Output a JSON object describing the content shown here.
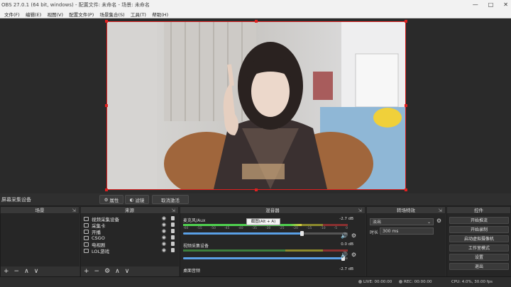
{
  "title_bar": {
    "title": "OBS 27.0.1 (64 bit, windows) - 配置文件: 未命名 - 场景: 未命名",
    "minimize": "—",
    "maximize": "□",
    "close": "✕"
  },
  "menu": [
    "文件(F)",
    "编辑(E)",
    "视图(V)",
    "配置文件(P)",
    "场景集合(S)",
    "工具(T)",
    "帮助(H)"
  ],
  "preview_controls": {
    "source_label": "屏幕采集设备",
    "properties_label": "属性",
    "filters_label": "滤镜",
    "deactivate_label": "取消激活"
  },
  "docks": {
    "scenes": "场景",
    "sources": "来源",
    "mixer": "混音器",
    "transitions": "转场特效",
    "controls": "控件"
  },
  "sources": [
    {
      "name": "视频采集设备"
    },
    {
      "name": "采集卡"
    },
    {
      "name": "开播"
    },
    {
      "name": "CSGO"
    },
    {
      "name": "电视剧"
    },
    {
      "name": "LOL游戏"
    }
  ],
  "mixer": {
    "channels": [
      {
        "name": "麦克风/Aux",
        "db": "-2.7 dB",
        "level": 0.72,
        "volume": 0.72
      },
      {
        "name": "视频采集设备",
        "db": "0.0 dB",
        "level": 0.0,
        "volume": 0.97
      },
      {
        "name": "桌面音频",
        "db": "-2.7 dB",
        "level": 0.0,
        "volume": 0.72
      }
    ],
    "tick_labels": [
      "-60",
      "-55",
      "-50",
      "-45",
      "-40",
      "-35",
      "-30",
      "-25",
      "-20",
      "-15",
      "-10",
      "-5",
      "0"
    ],
    "tooltip": "截图(Alt + A)"
  },
  "transitions": {
    "selected": "淡出",
    "duration_label": "时长",
    "duration_value": "300 ms"
  },
  "controls": [
    "开始推流",
    "开始录制",
    "启动虚拟摄像机",
    "工作室模式",
    "设置",
    "退出"
  ],
  "tools_icons": {
    "add": "+",
    "remove": "−",
    "settings": "⚙",
    "up": "∧",
    "down": "∨"
  },
  "status": {
    "live": "LIVE: 00:00:00",
    "rec": "REC: 00:00:00",
    "cpu": "CPU: 4.0%, 30.00 fps"
  },
  "colors": {
    "accent_red": "#e02020",
    "meter_green": "#4fd14f",
    "volume_blue": "#5aa0e6"
  }
}
